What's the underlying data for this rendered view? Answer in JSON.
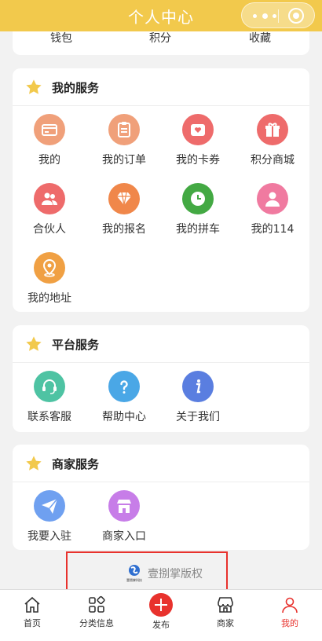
{
  "header": {
    "title": "个人中心"
  },
  "wallet": {
    "items": [
      "钱包",
      "积分",
      "收藏"
    ]
  },
  "services": {
    "title": "我的服务",
    "items": [
      {
        "label": "我的",
        "icon": "card-icon",
        "color": "#f0a07a"
      },
      {
        "label": "我的订单",
        "icon": "clipboard-icon",
        "color": "#f0a07a"
      },
      {
        "label": "我的卡券",
        "icon": "coupon-icon",
        "color": "#ee6b6b"
      },
      {
        "label": "积分商城",
        "icon": "gift-icon",
        "color": "#ee6b6b"
      },
      {
        "label": "合伙人",
        "icon": "partners-icon",
        "color": "#ee6b6b"
      },
      {
        "label": "我的报名",
        "icon": "diamond-icon",
        "color": "#f0874a"
      },
      {
        "label": "我的拼车",
        "icon": "clock-icon",
        "color": "#43a943"
      },
      {
        "label": "我的114",
        "icon": "person-icon",
        "color": "#f07aa0"
      },
      {
        "label": "我的地址",
        "icon": "location-icon",
        "color": "#f0a043"
      }
    ]
  },
  "platform": {
    "title": "平台服务",
    "items": [
      {
        "label": "联系客服",
        "icon": "headset-icon",
        "color": "#4ec3a3"
      },
      {
        "label": "帮助中心",
        "icon": "help-icon",
        "color": "#4aa7e6"
      },
      {
        "label": "关于我们",
        "icon": "info-icon",
        "color": "#5a7ee0"
      }
    ]
  },
  "merchant": {
    "title": "商家服务",
    "items": [
      {
        "label": "我要入驻",
        "icon": "paper-plane-icon",
        "color": "#6fa0f0"
      },
      {
        "label": "商家入口",
        "icon": "store-icon",
        "color": "#c77de8"
      }
    ]
  },
  "copyright": {
    "text": "壹捌掌版权",
    "logo_text": "壹捌掌科技"
  },
  "tabbar": {
    "items": [
      {
        "label": "首页"
      },
      {
        "label": "分类信息"
      },
      {
        "label": "发布"
      },
      {
        "label": "商家"
      },
      {
        "label": "我的"
      }
    ],
    "active_color": "#e8322d"
  },
  "colors": {
    "header_bg": "#f2c94c",
    "star": "#f2c94c",
    "page_bg": "#f2f2f2"
  }
}
